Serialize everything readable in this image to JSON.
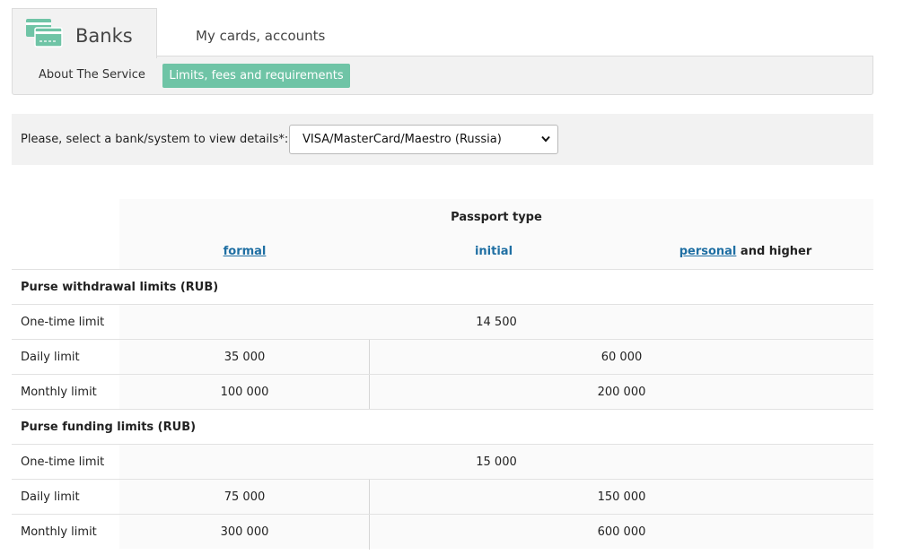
{
  "tabs": {
    "banks_label": "Banks",
    "cards_label": "My cards, accounts",
    "icon": "cards-icon"
  },
  "subnav": {
    "about_label": "About The Service",
    "active_label": "Limits, fees and requirements",
    "accent_color": "#6fc4a6"
  },
  "selector": {
    "label": "Please, select a bank/system to view details*:",
    "value": "VISA/MasterCard/Maestro (Russia)"
  },
  "table": {
    "passport_type": "Passport type",
    "columns": {
      "formal": "formal",
      "initial": "initial",
      "personal": "personal",
      "personal_suffix": " and higher"
    },
    "sections": [
      {
        "title": "Purse withdrawal limits (RUB)",
        "rows": [
          {
            "label": "One-time limit",
            "all": "14 500"
          },
          {
            "label": "Daily limit",
            "formal": "35 000",
            "rest": "60 000"
          },
          {
            "label": "Monthly limit",
            "formal": "100 000",
            "rest": "200 000"
          }
        ]
      },
      {
        "title": "Purse funding limits (RUB)",
        "rows": [
          {
            "label": "One-time limit",
            "all": "15 000"
          },
          {
            "label": "Daily limit",
            "formal": "75 000",
            "rest": "150 000"
          },
          {
            "label": "Monthly limit",
            "formal": "300 000",
            "rest": "600 000"
          }
        ]
      }
    ]
  }
}
